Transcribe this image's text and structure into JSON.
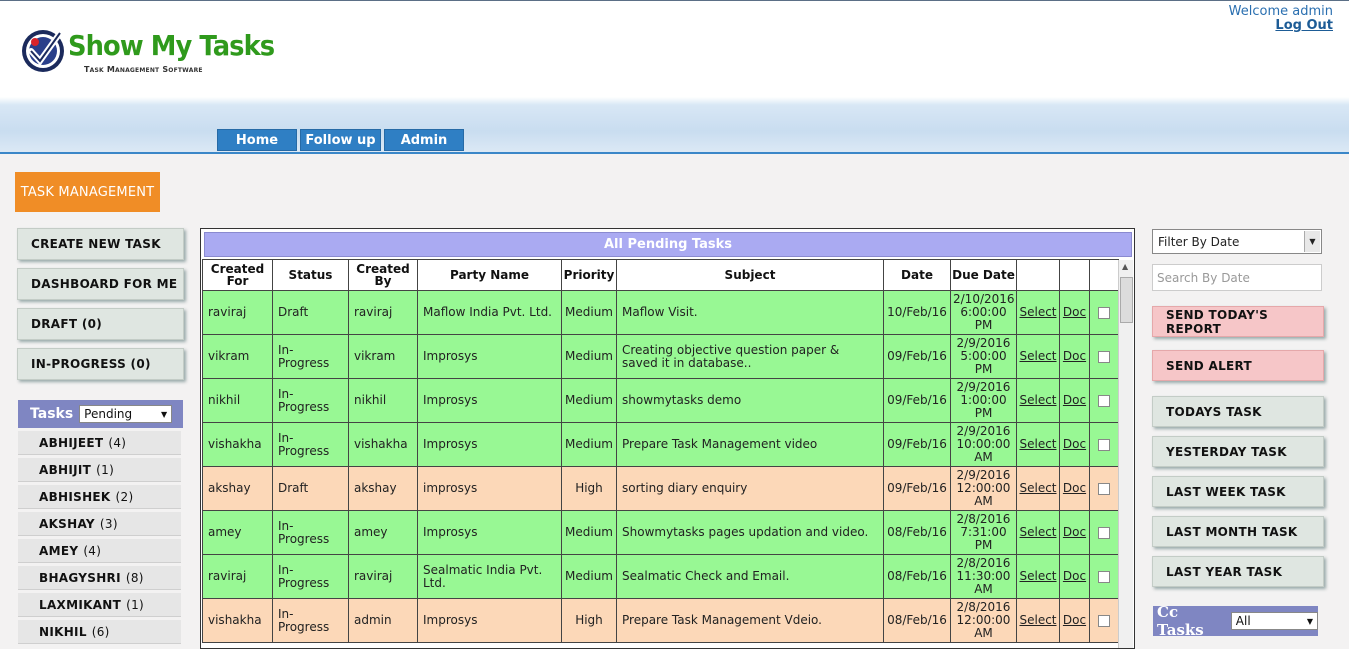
{
  "header": {
    "logo_title": "Show My Tasks",
    "logo_subtitle": "Task Management Software",
    "welcome": "Welcome admin",
    "logout": "Log Out",
    "nav": [
      "Home",
      "Follow up",
      "Admin"
    ]
  },
  "left": {
    "banner": "TASK MANAGEMENT",
    "buttons": [
      "CREATE NEW TASK",
      "DASHBOARD FOR ME",
      "DRAFT (0)",
      "IN-PROGRESS (0)"
    ],
    "tasks_label": "Tasks",
    "tasks_filter": "Pending",
    "users": [
      {
        "name": "ABHIJEET",
        "count": "(4)"
      },
      {
        "name": "ABHIJIT",
        "count": "(1)"
      },
      {
        "name": "ABHISHEK",
        "count": "(2)"
      },
      {
        "name": "AKSHAY",
        "count": "(3)"
      },
      {
        "name": "AMEY",
        "count": "(4)"
      },
      {
        "name": "BHAGYSHRI",
        "count": "(8)"
      },
      {
        "name": "LAXMIKANT",
        "count": "(1)"
      },
      {
        "name": "NIKHIL",
        "count": "(6)"
      }
    ]
  },
  "table": {
    "title": "All Pending Tasks",
    "headers": [
      "Created For",
      "Status",
      "Created By",
      "Party Name",
      "Priority",
      "Subject",
      "Date",
      "Due Date"
    ],
    "select_label": "Select",
    "doc_label": "Doc",
    "rows": [
      {
        "created_for": "raviraj",
        "status": "Draft",
        "created_by": "raviraj",
        "party": "Maflow India Pvt. Ltd.",
        "priority": "Medium",
        "subject": "Maflow Visit.",
        "date": "10/Feb/16",
        "due_date": "2/10/2016 6:00:00 PM",
        "row_color": "green"
      },
      {
        "created_for": "vikram",
        "status": "In-Progress",
        "created_by": "vikram",
        "party": "Improsys",
        "priority": "Medium",
        "subject": "Creating objective question paper & saved it in database..",
        "date": "09/Feb/16",
        "due_date": "2/9/2016 5:00:00 PM",
        "row_color": "green"
      },
      {
        "created_for": "nikhil",
        "status": "In-Progress",
        "created_by": "nikhil",
        "party": "Improsys",
        "priority": "Medium",
        "subject": "showmytasks demo",
        "date": "09/Feb/16",
        "due_date": "2/9/2016 1:00:00 PM",
        "row_color": "green"
      },
      {
        "created_for": "vishakha",
        "status": "In-Progress",
        "created_by": "vishakha",
        "party": "Improsys",
        "priority": "Medium",
        "subject": "Prepare Task Management video",
        "date": "09/Feb/16",
        "due_date": "2/9/2016 10:00:00 AM",
        "row_color": "green"
      },
      {
        "created_for": "akshay",
        "status": "Draft",
        "created_by": "akshay",
        "party": "improsys",
        "priority": "High",
        "subject": "sorting diary enquiry",
        "date": "09/Feb/16",
        "due_date": "2/9/2016 12:00:00 AM",
        "row_color": "peach"
      },
      {
        "created_for": "amey",
        "status": "In-Progress",
        "created_by": "amey",
        "party": "Improsys",
        "priority": "Medium",
        "subject": "Showmytasks pages updation and video.",
        "date": "08/Feb/16",
        "due_date": "2/8/2016 7:31:00 PM",
        "row_color": "green"
      },
      {
        "created_for": "raviraj",
        "status": "In-Progress",
        "created_by": "raviraj",
        "party": "Sealmatic India Pvt. Ltd.",
        "priority": "Medium",
        "subject": "Sealmatic Check and Email.",
        "date": "08/Feb/16",
        "due_date": "2/8/2016 11:30:00 AM",
        "row_color": "green"
      },
      {
        "created_for": "vishakha",
        "status": "In-Progress",
        "created_by": "admin",
        "party": "Improsys",
        "priority": "High",
        "subject": "Prepare Task Management Vdeio.",
        "date": "08/Feb/16",
        "due_date": "2/8/2016 12:00:00 AM",
        "row_color": "peach"
      }
    ]
  },
  "right": {
    "filter_select": "Filter By Date",
    "date_search_placeholder": "Search By Date",
    "buttons": [
      {
        "label": "SEND TODAY'S REPORT",
        "style": "pink"
      },
      {
        "label": "SEND ALERT",
        "style": "pink"
      },
      {
        "label": "TODAYS TASK",
        "style": "grey"
      },
      {
        "label": "YESTERDAY TASK",
        "style": "grey"
      },
      {
        "label": "LAST WEEK TASK",
        "style": "grey"
      },
      {
        "label": "LAST MONTH TASK",
        "style": "grey"
      },
      {
        "label": "LAST YEAR TASK",
        "style": "grey"
      }
    ],
    "cc_label": "Cc Tasks",
    "cc_filter": "All"
  },
  "colors": {
    "nav_blue": "#2f7fc4",
    "banner_orange": "#f08d26",
    "panel_purple": "#7f86c2",
    "row_green": "#98f894",
    "row_peach": "#fcd8b8",
    "alert_pink": "#f6c6c8"
  },
  "icons": {
    "logo": "checkmark-globe-logo",
    "dropdown": "chevron-down-icon"
  }
}
